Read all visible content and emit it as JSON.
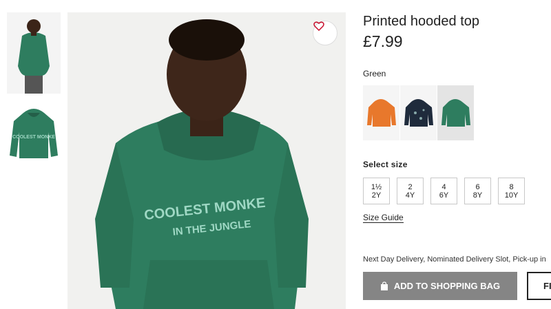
{
  "product": {
    "title": "Printed hooded top",
    "price": "£7.99",
    "hoodie_print_line1": "COOLEST MONKE",
    "hoodie_print_line2": "IN THE JUNGLE",
    "hoodie_color": "#2e7d5f"
  },
  "colour": {
    "label": "Green",
    "options": [
      {
        "name": "orange",
        "hex": "#e8782c"
      },
      {
        "name": "navy",
        "hex": "#1f2b3c"
      },
      {
        "name": "green",
        "hex": "#2e7d5f",
        "selected": true
      }
    ]
  },
  "sizes": {
    "label": "Select size",
    "options": [
      {
        "top": "1½",
        "bottom": "2Y"
      },
      {
        "top": "2",
        "bottom": "4Y"
      },
      {
        "top": "4",
        "bottom": "6Y"
      },
      {
        "top": "6",
        "bottom": "8Y"
      },
      {
        "top": "8",
        "bottom": "10Y"
      }
    ],
    "guide": "Size Guide"
  },
  "delivery": "Next Day Delivery, Nominated Delivery Slot, Pick-up in",
  "actions": {
    "add_to_bag": "ADD TO SHOPPING BAG",
    "second": "FI"
  },
  "icons": [
    "heart-icon",
    "shopping-bag-icon"
  ]
}
